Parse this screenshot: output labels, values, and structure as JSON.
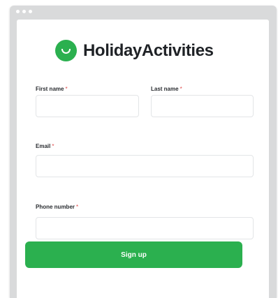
{
  "brand": {
    "name": "HolidayActivities",
    "accent_color": "#2bb04f",
    "logo_icon": "smile-logo-icon"
  },
  "form": {
    "first_name_label": "First name",
    "last_name_label": "Last name",
    "email_label": "Email",
    "phone_label": "Phone number",
    "required_marker": "*",
    "first_name_value": "",
    "last_name_value": "",
    "email_value": "",
    "phone_value": "",
    "submit_label": "Sign up"
  }
}
